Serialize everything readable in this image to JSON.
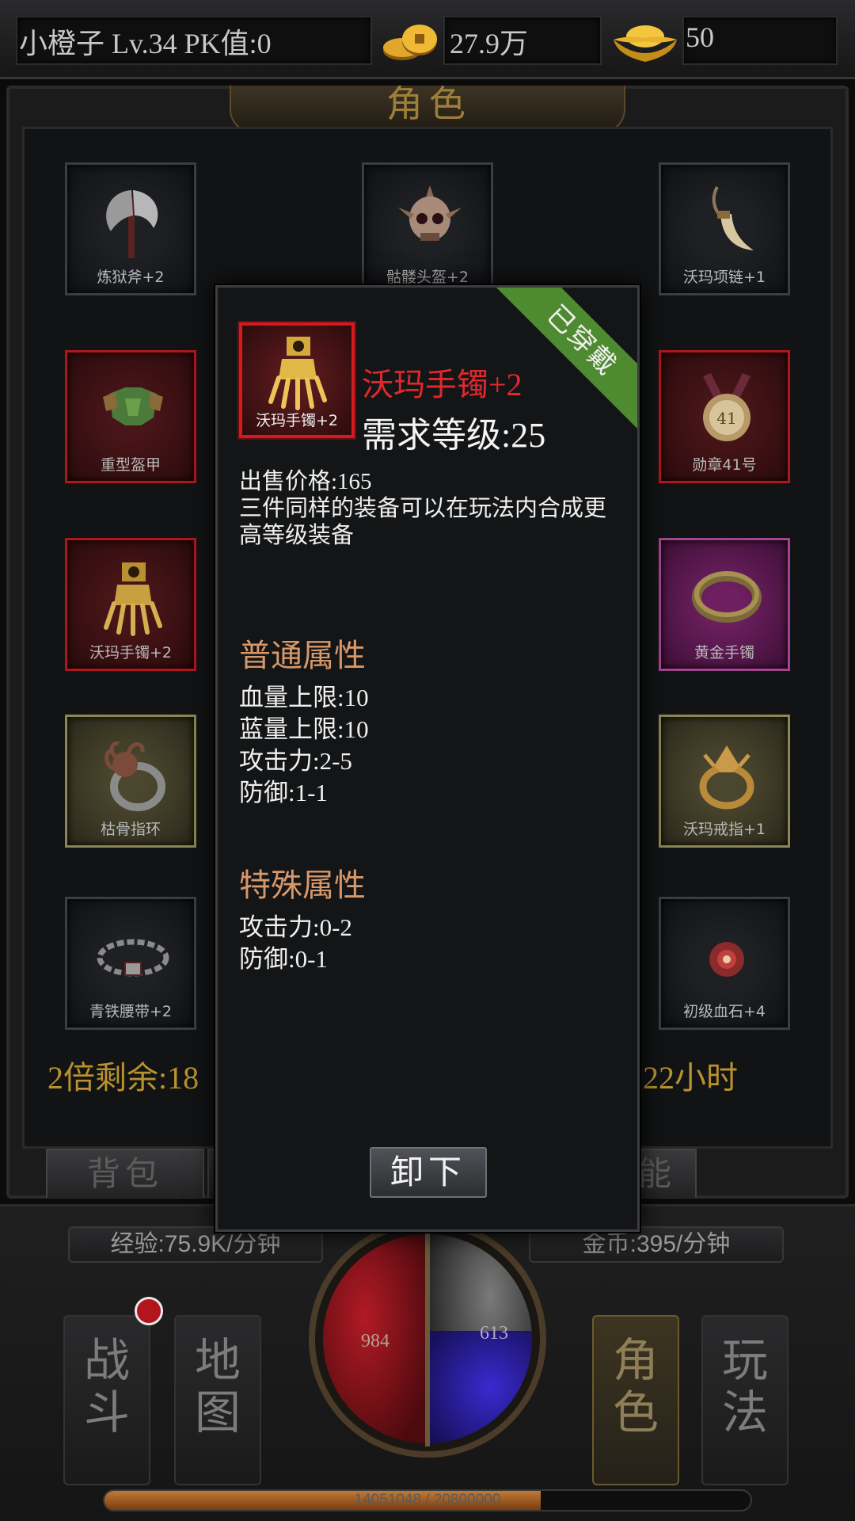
{
  "topbar": {
    "player_info": "小橙子  Lv.34 PK值:0",
    "gold": "27.9万",
    "ingot": "50",
    "gold_icon": "gold-coins-icon",
    "ingot_icon": "gold-ingot-icon"
  },
  "panel": {
    "title": "角色"
  },
  "slots": {
    "weapon": "炼狱斧+2",
    "helmet": "骷髅头盔+2",
    "necklace": "沃玛项链+1",
    "armor": "重型盔甲",
    "medal": "勋章41号",
    "bracelet_left": "沃玛手镯+2",
    "bracelet_right": "黄金手镯",
    "ring_left": "枯骨指环",
    "ring_right": "沃玛戒指+1",
    "belt": "青铁腰带+2",
    "gem": "初级血石+4"
  },
  "bonus": {
    "left": "2倍剩余:18",
    "right": "22小时"
  },
  "tabs": {
    "bag": "背包",
    "skill": "能"
  },
  "hud": {
    "exp_rate": "经验:75.9K/分钟",
    "gold_rate": "金币:395/分钟",
    "hp": "984",
    "mp": "613",
    "exp_text": "14051048 / 20800000",
    "exp_current": 14051048,
    "exp_max": 20800000,
    "nav": {
      "battle": [
        "战",
        "斗"
      ],
      "map": [
        "地",
        "图"
      ],
      "role": [
        "角",
        "色"
      ],
      "play": [
        "玩",
        "法"
      ]
    }
  },
  "popup": {
    "slot_label": "沃玛手镯+2",
    "ribbon": "已穿戴",
    "item_name": "沃玛手镯+2",
    "required_level": "需求等级:25",
    "sell_price": "出售价格:165",
    "description": "三件同样的装备可以在玩法内合成更高等级装备",
    "normal_title": "普通属性",
    "normal_stats": [
      "血量上限:10",
      "蓝量上限:10",
      "攻击力:2-5",
      "防御:1-1"
    ],
    "special_title": "特殊属性",
    "special_stats": [
      "攻击力:0-2",
      "防御:0-1"
    ],
    "unequip_button": "卸下"
  }
}
